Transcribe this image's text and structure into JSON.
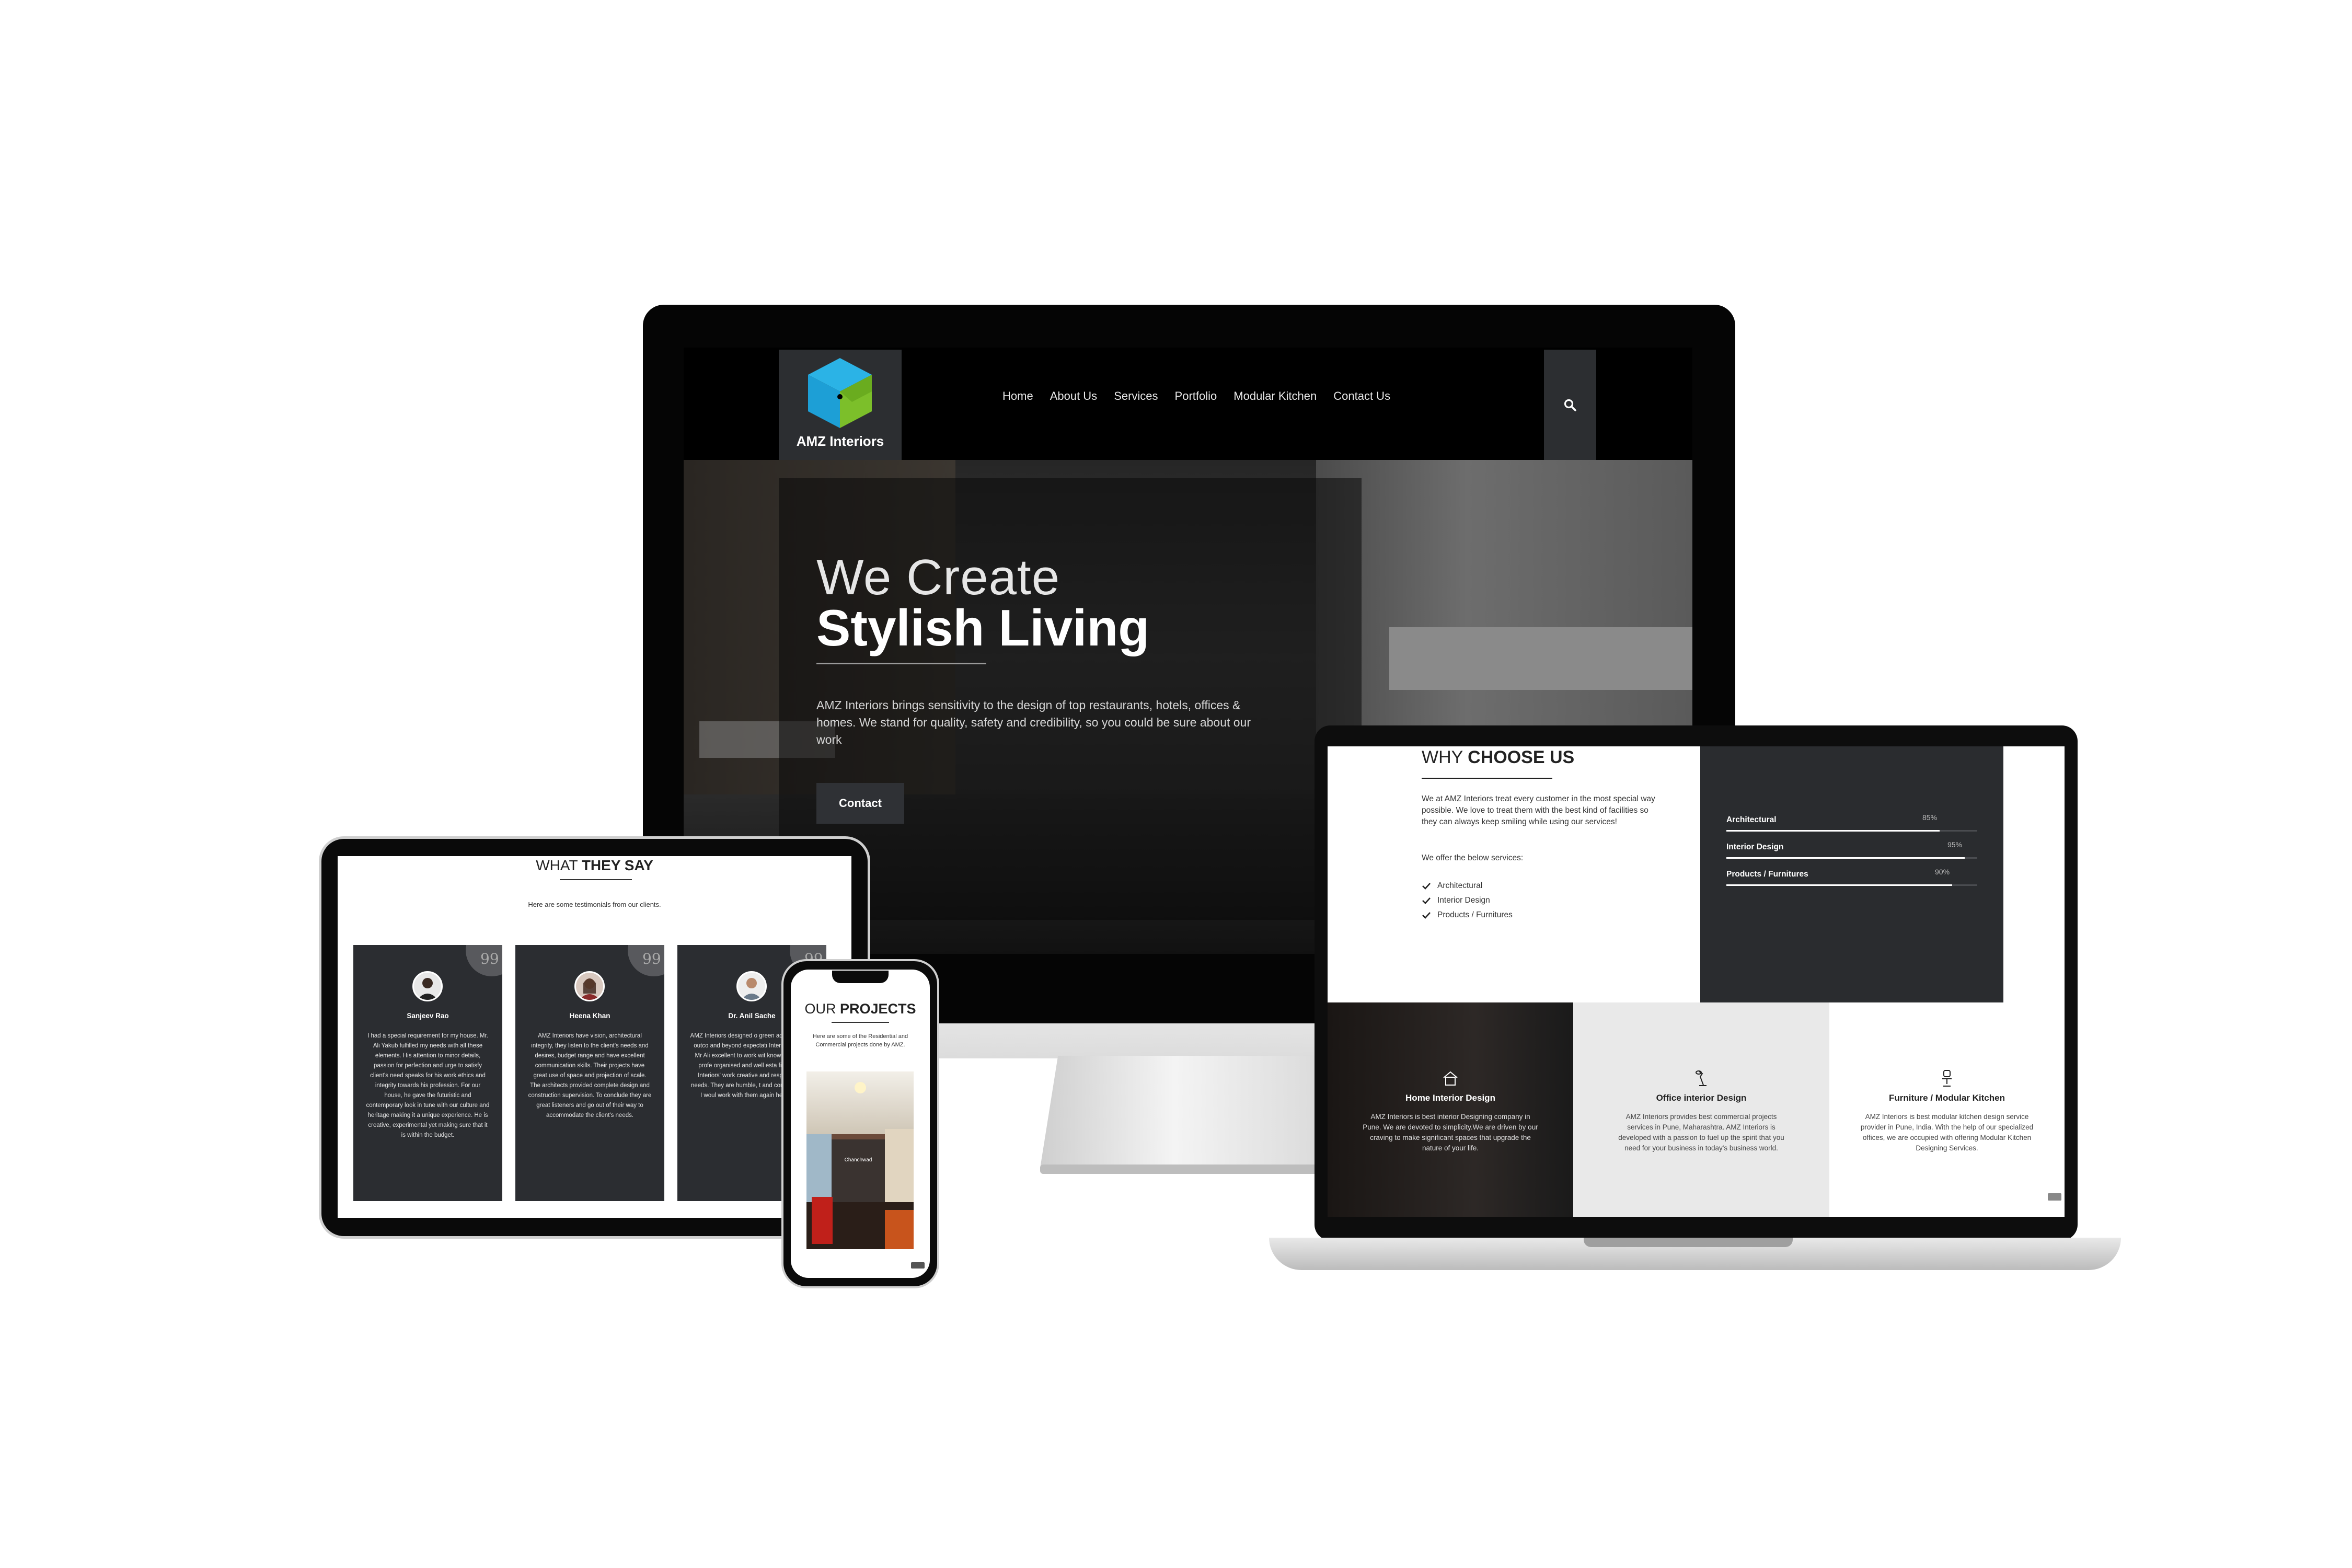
{
  "colors": {
    "dark_panel": "#2c2e31",
    "accent_blue": "#2bb3e6",
    "accent_green": "#7cbf2a"
  },
  "desktop": {
    "logo": {
      "icon": "cube-logo-icon",
      "text": "AMZ Interiors"
    },
    "nav": [
      "Home",
      "About Us",
      "Services",
      "Portfolio",
      "Modular Kitchen",
      "Contact Us"
    ],
    "search_icon": "search-icon",
    "hero": {
      "line1": "We Create",
      "line2": "Stylish Living",
      "description": "AMZ Interiors brings sensitivity to the design of top restaurants, hotels, offices & homes. We stand for quality, safety and credibility, so you could be sure about our work",
      "button": "Contact"
    }
  },
  "laptop": {
    "why_title_light": "WHY ",
    "why_title_bold": "CHOOSE US",
    "why_desc": "We at AMZ Interiors treat every customer in the most special way possible. We love to treat them with the best kind of facilities so they can always keep smiling while using our services!",
    "offer_text": "We offer the below services:",
    "services": [
      "Architectural",
      "Interior Design",
      "Products / Furnitures"
    ],
    "skills": [
      {
        "label": "Architectural",
        "percent": 85,
        "percent_text": "85%"
      },
      {
        "label": "Interior Design",
        "percent": 95,
        "percent_text": "95%"
      },
      {
        "label": "Products / Furnitures",
        "percent": 90,
        "percent_text": "90%"
      }
    ],
    "offerings": [
      {
        "icon": "home-icon",
        "title": "Home Interior Design",
        "desc": "AMZ Interiors is best interior Designing company in Pune. We are devoted to simplicity.We are driven by our craving to make significant spaces that upgrade the nature of your life."
      },
      {
        "icon": "desk-lamp-icon",
        "title": "Office interior Design",
        "desc": "AMZ Interiors provides best commercial projects services in Pune, Maharashtra. AMZ Interiors is developed with a passion to fuel up the spirit that you need for your business in today's business world."
      },
      {
        "icon": "chair-icon",
        "title": "Furniture / Modular Kitchen",
        "desc": "AMZ Interiors is best modular kitchen design service provider in Pune, India. With the help of our specialized offices, we are occupied with offering Modular Kitchen Designing Services."
      }
    ]
  },
  "tablet": {
    "title_light": "WHAT ",
    "title_bold": "THEY SAY",
    "subtitle": "Here are some testimonials from our clients.",
    "quote_mark": "99",
    "testimonials": [
      {
        "name": "Sanjeev Rao",
        "text": "I had a special requirement for my house. Mr. Ali Yakub fulfilled my needs with all these elements. His attention to minor details, passion for perfection and urge to satisfy client's need speaks for his work ethics and integrity towards his profession. For our house, he gave the futuristic and contemporary look in tune with our culture and heritage making it a unique experience. He is creative, experimental yet making sure that it is within the budget."
      },
      {
        "name": "Heena Khan",
        "text": "AMZ Interiors have vision, architectural integrity, they listen to the client's needs and desires, budget range and have excellent communication skills. Their projects have great use of space and projection of scale. The architects provided complete design and construction supervision. To conclude they are great listeners and go out of their way to accommodate the client's needs."
      },
      {
        "name": "Dr. Anil Sache",
        "text": "AMZ Interiors designed o green addition. Final outco and beyond expectati Interiors, led by Mr Ali excellent to work wit knowledgeable, profe organised and well esta field. AMZ Interiors' work creative and responded di needs. They are humble, t and consistent and I woul work with them again hesitation."
      }
    ]
  },
  "phone": {
    "title_light": "OUR ",
    "title_bold": "PROJECTS",
    "subtitle": "Here are some of the Residential and Commercial projects done by AMZ.",
    "image_label": "Chanchwad"
  }
}
